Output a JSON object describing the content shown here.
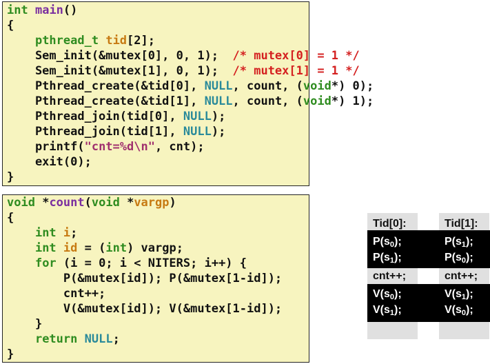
{
  "main_function": {
    "lines": [
      [
        {
          "t": "int",
          "c": "type"
        },
        {
          "t": " "
        },
        {
          "t": "main",
          "c": "func"
        },
        {
          "t": "()"
        }
      ],
      [
        {
          "t": "{"
        }
      ],
      [
        {
          "t": "    "
        },
        {
          "t": "pthread_t",
          "c": "type"
        },
        {
          "t": " "
        },
        {
          "t": "tid",
          "c": "var"
        },
        {
          "t": "[2];"
        }
      ],
      [
        {
          "t": "    Sem_init(&mutex[0], 0, 1);  "
        },
        {
          "t": "/* mutex[0] = 1 */",
          "c": "comment"
        }
      ],
      [
        {
          "t": "    Sem_init(&mutex[1], 0, 1);  "
        },
        {
          "t": "/* mutex[1] = 1 */",
          "c": "comment"
        }
      ],
      [
        {
          "t": "    Pthread_create(&tid[0], "
        },
        {
          "t": "NULL",
          "c": "const"
        },
        {
          "t": ", count, ("
        },
        {
          "t": "void",
          "c": "type"
        },
        {
          "t": "*) 0);"
        }
      ],
      [
        {
          "t": "    Pthread_create(&tid[1], "
        },
        {
          "t": "NULL",
          "c": "const"
        },
        {
          "t": ", count, ("
        },
        {
          "t": "void",
          "c": "type"
        },
        {
          "t": "*) 1);"
        }
      ],
      [
        {
          "t": "    Pthread_join(tid[0], "
        },
        {
          "t": "NULL",
          "c": "const"
        },
        {
          "t": ");"
        }
      ],
      [
        {
          "t": "    Pthread_join(tid[1], "
        },
        {
          "t": "NULL",
          "c": "const"
        },
        {
          "t": ");"
        }
      ],
      [
        {
          "t": "    printf("
        },
        {
          "t": "\"cnt=%d\\n\"",
          "c": "string"
        },
        {
          "t": ", cnt);"
        }
      ],
      [
        {
          "t": "    exit(0);"
        }
      ],
      [
        {
          "t": "}"
        }
      ]
    ]
  },
  "count_function": {
    "lines": [
      [
        {
          "t": "void",
          "c": "type"
        },
        {
          "t": " *"
        },
        {
          "t": "count",
          "c": "func"
        },
        {
          "t": "("
        },
        {
          "t": "void",
          "c": "type"
        },
        {
          "t": " *"
        },
        {
          "t": "vargp",
          "c": "var"
        },
        {
          "t": ")"
        }
      ],
      [
        {
          "t": "{"
        }
      ],
      [
        {
          "t": "    "
        },
        {
          "t": "int",
          "c": "type"
        },
        {
          "t": " "
        },
        {
          "t": "i",
          "c": "var"
        },
        {
          "t": ";"
        }
      ],
      [
        {
          "t": "    "
        },
        {
          "t": "int",
          "c": "type"
        },
        {
          "t": " "
        },
        {
          "t": "id",
          "c": "var"
        },
        {
          "t": " = ("
        },
        {
          "t": "int",
          "c": "type"
        },
        {
          "t": ") vargp;"
        }
      ],
      [
        {
          "t": "    "
        },
        {
          "t": "for",
          "c": "type"
        },
        {
          "t": " (i = 0; i < NITERS; i++) {"
        }
      ],
      [
        {
          "t": "        P(&mutex[id]); P(&mutex[1-id]);"
        }
      ],
      [
        {
          "t": "        cnt++;"
        }
      ],
      [
        {
          "t": "        V(&mutex[id]); V(&mutex[1-id]);"
        }
      ],
      [
        {
          "t": "    }"
        }
      ],
      [
        {
          "t": "    "
        },
        {
          "t": "return",
          "c": "type"
        },
        {
          "t": " "
        },
        {
          "t": "NULL",
          "c": "const"
        },
        {
          "t": ";"
        }
      ],
      [
        {
          "t": "}"
        }
      ]
    ]
  },
  "thread_table": {
    "columns": [
      {
        "header": "Tid[0]:",
        "rows": [
          {
            "op": "P(s",
            "sub": "0",
            "end": ");"
          },
          {
            "op": "P(s",
            "sub": "1",
            "end": ");"
          },
          {
            "op": "cnt++;",
            "sub": "",
            "end": ""
          },
          {
            "op": "V(s",
            "sub": "0",
            "end": ");"
          },
          {
            "op": "V(s",
            "sub": "1",
            "end": ");"
          }
        ]
      },
      {
        "header": "Tid[1]:",
        "rows": [
          {
            "op": "P(s",
            "sub": "1",
            "end": ");"
          },
          {
            "op": "P(s",
            "sub": "0",
            "end": ");"
          },
          {
            "op": "cnt++;",
            "sub": "",
            "end": ""
          },
          {
            "op": "V(s",
            "sub": "1",
            "end": ");"
          },
          {
            "op": "V(s",
            "sub": "0",
            "end": ");"
          }
        ]
      }
    ]
  },
  "colors": {
    "code_background": "#f7f4bf",
    "keyword_type": "#2f8c20",
    "function_name": "#7a2fa0",
    "identifier": "#c77a12",
    "constant": "#2a8a9a",
    "comment": "#d42020",
    "string": "#a0306e",
    "column_background": "#e0e0e0",
    "band": "#000000"
  }
}
